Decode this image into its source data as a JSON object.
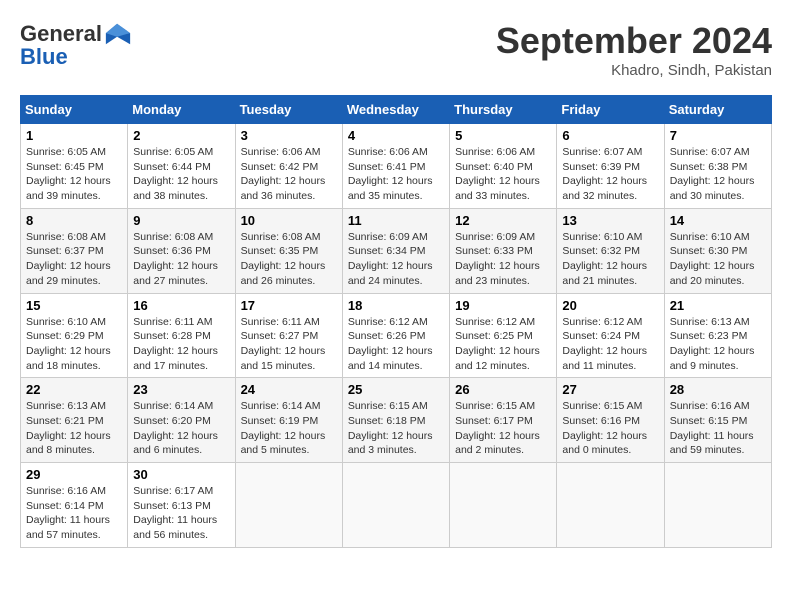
{
  "header": {
    "logo_line1": "General",
    "logo_line2": "Blue",
    "month_title": "September 2024",
    "location": "Khadro, Sindh, Pakistan"
  },
  "weekdays": [
    "Sunday",
    "Monday",
    "Tuesday",
    "Wednesday",
    "Thursday",
    "Friday",
    "Saturday"
  ],
  "weeks": [
    [
      {
        "day": "1",
        "info": "Sunrise: 6:05 AM\nSunset: 6:45 PM\nDaylight: 12 hours\nand 39 minutes."
      },
      {
        "day": "2",
        "info": "Sunrise: 6:05 AM\nSunset: 6:44 PM\nDaylight: 12 hours\nand 38 minutes."
      },
      {
        "day": "3",
        "info": "Sunrise: 6:06 AM\nSunset: 6:42 PM\nDaylight: 12 hours\nand 36 minutes."
      },
      {
        "day": "4",
        "info": "Sunrise: 6:06 AM\nSunset: 6:41 PM\nDaylight: 12 hours\nand 35 minutes."
      },
      {
        "day": "5",
        "info": "Sunrise: 6:06 AM\nSunset: 6:40 PM\nDaylight: 12 hours\nand 33 minutes."
      },
      {
        "day": "6",
        "info": "Sunrise: 6:07 AM\nSunset: 6:39 PM\nDaylight: 12 hours\nand 32 minutes."
      },
      {
        "day": "7",
        "info": "Sunrise: 6:07 AM\nSunset: 6:38 PM\nDaylight: 12 hours\nand 30 minutes."
      }
    ],
    [
      {
        "day": "8",
        "info": "Sunrise: 6:08 AM\nSunset: 6:37 PM\nDaylight: 12 hours\nand 29 minutes."
      },
      {
        "day": "9",
        "info": "Sunrise: 6:08 AM\nSunset: 6:36 PM\nDaylight: 12 hours\nand 27 minutes."
      },
      {
        "day": "10",
        "info": "Sunrise: 6:08 AM\nSunset: 6:35 PM\nDaylight: 12 hours\nand 26 minutes."
      },
      {
        "day": "11",
        "info": "Sunrise: 6:09 AM\nSunset: 6:34 PM\nDaylight: 12 hours\nand 24 minutes."
      },
      {
        "day": "12",
        "info": "Sunrise: 6:09 AM\nSunset: 6:33 PM\nDaylight: 12 hours\nand 23 minutes."
      },
      {
        "day": "13",
        "info": "Sunrise: 6:10 AM\nSunset: 6:32 PM\nDaylight: 12 hours\nand 21 minutes."
      },
      {
        "day": "14",
        "info": "Sunrise: 6:10 AM\nSunset: 6:30 PM\nDaylight: 12 hours\nand 20 minutes."
      }
    ],
    [
      {
        "day": "15",
        "info": "Sunrise: 6:10 AM\nSunset: 6:29 PM\nDaylight: 12 hours\nand 18 minutes."
      },
      {
        "day": "16",
        "info": "Sunrise: 6:11 AM\nSunset: 6:28 PM\nDaylight: 12 hours\nand 17 minutes."
      },
      {
        "day": "17",
        "info": "Sunrise: 6:11 AM\nSunset: 6:27 PM\nDaylight: 12 hours\nand 15 minutes."
      },
      {
        "day": "18",
        "info": "Sunrise: 6:12 AM\nSunset: 6:26 PM\nDaylight: 12 hours\nand 14 minutes."
      },
      {
        "day": "19",
        "info": "Sunrise: 6:12 AM\nSunset: 6:25 PM\nDaylight: 12 hours\nand 12 minutes."
      },
      {
        "day": "20",
        "info": "Sunrise: 6:12 AM\nSunset: 6:24 PM\nDaylight: 12 hours\nand 11 minutes."
      },
      {
        "day": "21",
        "info": "Sunrise: 6:13 AM\nSunset: 6:23 PM\nDaylight: 12 hours\nand 9 minutes."
      }
    ],
    [
      {
        "day": "22",
        "info": "Sunrise: 6:13 AM\nSunset: 6:21 PM\nDaylight: 12 hours\nand 8 minutes."
      },
      {
        "day": "23",
        "info": "Sunrise: 6:14 AM\nSunset: 6:20 PM\nDaylight: 12 hours\nand 6 minutes."
      },
      {
        "day": "24",
        "info": "Sunrise: 6:14 AM\nSunset: 6:19 PM\nDaylight: 12 hours\nand 5 minutes."
      },
      {
        "day": "25",
        "info": "Sunrise: 6:15 AM\nSunset: 6:18 PM\nDaylight: 12 hours\nand 3 minutes."
      },
      {
        "day": "26",
        "info": "Sunrise: 6:15 AM\nSunset: 6:17 PM\nDaylight: 12 hours\nand 2 minutes."
      },
      {
        "day": "27",
        "info": "Sunrise: 6:15 AM\nSunset: 6:16 PM\nDaylight: 12 hours\nand 0 minutes."
      },
      {
        "day": "28",
        "info": "Sunrise: 6:16 AM\nSunset: 6:15 PM\nDaylight: 11 hours\nand 59 minutes."
      }
    ],
    [
      {
        "day": "29",
        "info": "Sunrise: 6:16 AM\nSunset: 6:14 PM\nDaylight: 11 hours\nand 57 minutes."
      },
      {
        "day": "30",
        "info": "Sunrise: 6:17 AM\nSunset: 6:13 PM\nDaylight: 11 hours\nand 56 minutes."
      },
      {
        "day": "",
        "info": ""
      },
      {
        "day": "",
        "info": ""
      },
      {
        "day": "",
        "info": ""
      },
      {
        "day": "",
        "info": ""
      },
      {
        "day": "",
        "info": ""
      }
    ]
  ]
}
